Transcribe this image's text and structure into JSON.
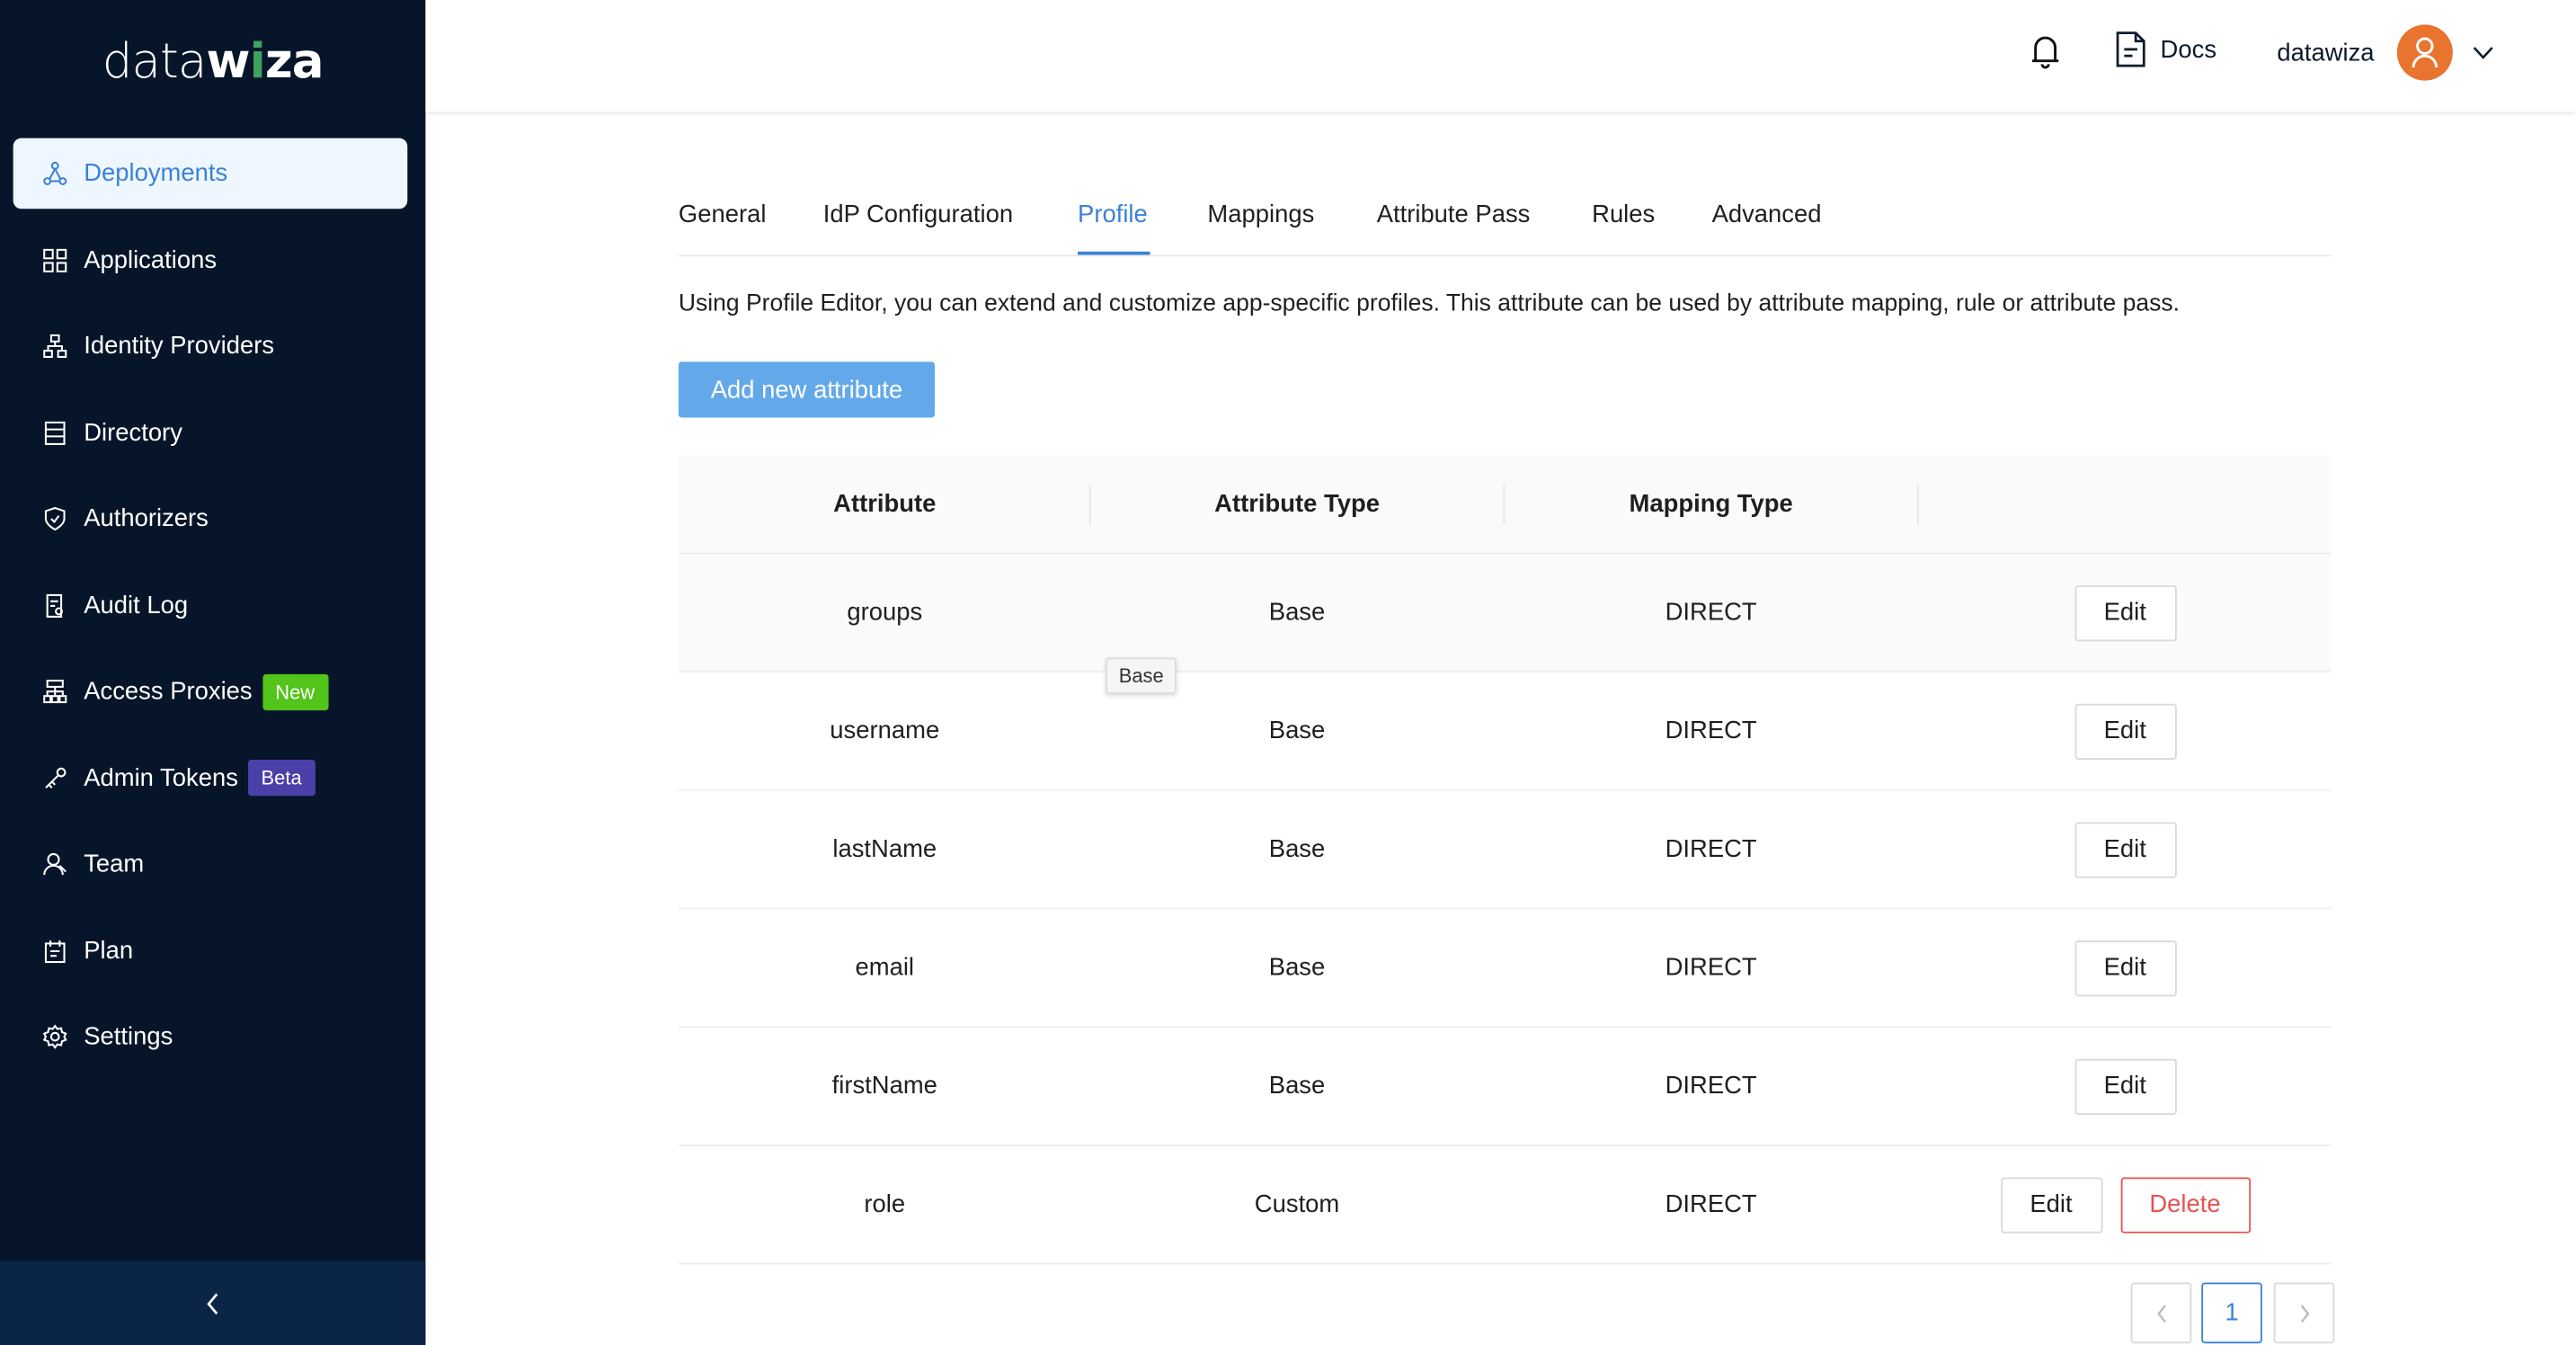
{
  "logo": {
    "text_thin": "data",
    "text_bold_w": "w",
    "text_bold_i": "i",
    "text_bold_rest": "za"
  },
  "sidebar": {
    "items": [
      {
        "label": "Deployments",
        "icon": "deployments-icon",
        "active": true
      },
      {
        "label": "Applications",
        "icon": "grid-icon"
      },
      {
        "label": "Identity Providers",
        "icon": "hierarchy-icon"
      },
      {
        "label": "Directory",
        "icon": "directory-icon"
      },
      {
        "label": "Authorizers",
        "icon": "shield-icon"
      },
      {
        "label": "Audit Log",
        "icon": "audit-log-icon"
      },
      {
        "label": "Access Proxies",
        "icon": "proxy-icon",
        "badge": "New",
        "badge_color": "#52c41a"
      },
      {
        "label": "Admin Tokens",
        "icon": "key-icon",
        "badge": "Beta",
        "badge_color": "#4b3fa8"
      },
      {
        "label": "Team",
        "icon": "team-icon"
      },
      {
        "label": "Plan",
        "icon": "plan-icon"
      },
      {
        "label": "Settings",
        "icon": "gear-icon"
      }
    ],
    "collapse_icon": "chevron-left-icon"
  },
  "header": {
    "docs": "Docs",
    "username": "datawiza",
    "avatar_color": "#e8742f"
  },
  "tabs": [
    "General",
    "IdP Configuration",
    "Profile",
    "Mappings",
    "Attribute Pass",
    "Rules",
    "Advanced"
  ],
  "active_tab": "Profile",
  "description": "Using Profile Editor, you can extend and customize app-specific profiles. This attribute can be used by attribute mapping, rule or attribute pass.",
  "add_button": "Add new attribute",
  "table": {
    "headers": [
      "Attribute",
      "Attribute Type",
      "Mapping Type"
    ],
    "rows": [
      {
        "attribute": "groups",
        "type": "Base",
        "mapping": "DIRECT",
        "edit": "Edit"
      },
      {
        "attribute": "username",
        "type": "Base",
        "mapping": "DIRECT",
        "edit": "Edit"
      },
      {
        "attribute": "lastName",
        "type": "Base",
        "mapping": "DIRECT",
        "edit": "Edit"
      },
      {
        "attribute": "email",
        "type": "Base",
        "mapping": "DIRECT",
        "edit": "Edit"
      },
      {
        "attribute": "firstName",
        "type": "Base",
        "mapping": "DIRECT",
        "edit": "Edit"
      },
      {
        "attribute": "role",
        "type": "Custom",
        "mapping": "DIRECT",
        "edit": "Edit",
        "delete": "Delete"
      }
    ]
  },
  "tooltip": "Base",
  "pagination": {
    "current": "1"
  },
  "colors": {
    "sidebar": "#061529",
    "accent": "#3b82d6",
    "primary_button": "#63a9ea",
    "danger": "#e55353"
  }
}
